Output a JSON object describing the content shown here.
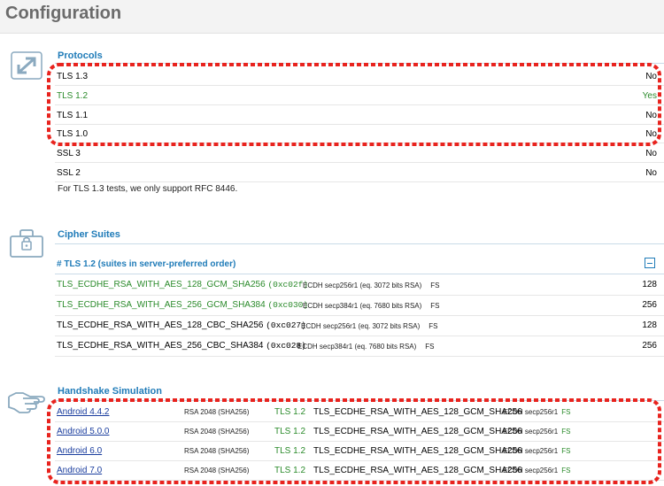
{
  "page": {
    "title": "Configuration"
  },
  "protocols": {
    "heading": "Protocols",
    "rows": [
      {
        "name": "TLS 1.3",
        "value": "No",
        "enabled": false
      },
      {
        "name": "TLS 1.2",
        "value": "Yes",
        "enabled": true
      },
      {
        "name": "TLS 1.1",
        "value": "No",
        "enabled": false
      },
      {
        "name": "TLS 1.0",
        "value": "No",
        "enabled": false
      },
      {
        "name": "SSL 3",
        "value": "No",
        "enabled": false
      },
      {
        "name": "SSL 2",
        "value": "No",
        "enabled": false
      }
    ],
    "note": "For TLS 1.3 tests, we only support RFC 8446."
  },
  "cipher_suites": {
    "heading": "Cipher Suites",
    "subheading": "# TLS 1.2 (suites in server-preferred order)",
    "rows": [
      {
        "name": "TLS_ECDHE_RSA_WITH_AES_128_GCM_SHA256",
        "hex": "(0xc02f)",
        "kex": "ECDH secp256r1 (eq. 3072 bits RSA)",
        "fs": "FS",
        "bits": "128",
        "strong": true
      },
      {
        "name": "TLS_ECDHE_RSA_WITH_AES_256_GCM_SHA384",
        "hex": "(0xc030)",
        "kex": "ECDH secp384r1 (eq. 7680 bits RSA)",
        "fs": "FS",
        "bits": "256",
        "strong": true
      },
      {
        "name": "TLS_ECDHE_RSA_WITH_AES_128_CBC_SHA256",
        "hex": "(0xc027)",
        "kex": "ECDH secp256r1 (eq. 3072 bits RSA)",
        "fs": "FS",
        "bits": "128",
        "strong": false
      },
      {
        "name": "TLS_ECDHE_RSA_WITH_AES_256_CBC_SHA384",
        "hex": "(0xc028)",
        "kex": "ECDH secp384r1 (eq. 7680 bits RSA)",
        "fs": "FS",
        "bits": "256",
        "strong": false
      }
    ]
  },
  "handshake": {
    "heading": "Handshake Simulation",
    "rows": [
      {
        "client": "Android 4.4.2",
        "cert": "RSA 2048 (SHA256)",
        "protocol": "TLS 1.2",
        "suite": "TLS_ECDHE_RSA_WITH_AES_128_GCM_SHA256",
        "kex": "ECDH secp256r1",
        "fs": "FS"
      },
      {
        "client": "Android 5.0.0",
        "cert": "RSA 2048 (SHA256)",
        "protocol": "TLS 1.2",
        "suite": "TLS_ECDHE_RSA_WITH_AES_128_GCM_SHA256",
        "kex": "ECDH secp256r1",
        "fs": "FS"
      },
      {
        "client": "Android 6.0",
        "cert": "RSA 2048 (SHA256)",
        "protocol": "TLS 1.2",
        "suite": "TLS_ECDHE_RSA_WITH_AES_128_GCM_SHA256",
        "kex": "ECDH secp256r1",
        "fs": "FS"
      },
      {
        "client": "Android 7.0",
        "cert": "RSA 2048 (SHA256)",
        "protocol": "TLS 1.2",
        "suite": "TLS_ECDHE_RSA_WITH_AES_128_GCM_SHA256",
        "kex": "ECDH secp256r1",
        "fs": "FS"
      }
    ]
  },
  "icons": {
    "protocols": "expand-arrows-icon",
    "cipher_suites": "lock-briefcase-icon",
    "handshake": "handshake-icon",
    "collapse": "collapse-minus-icon"
  },
  "colors": {
    "heading": "#1f7bb8",
    "enabled": "#2a8a2a",
    "link": "#1a3d9e",
    "annotation": "#e8231e"
  }
}
